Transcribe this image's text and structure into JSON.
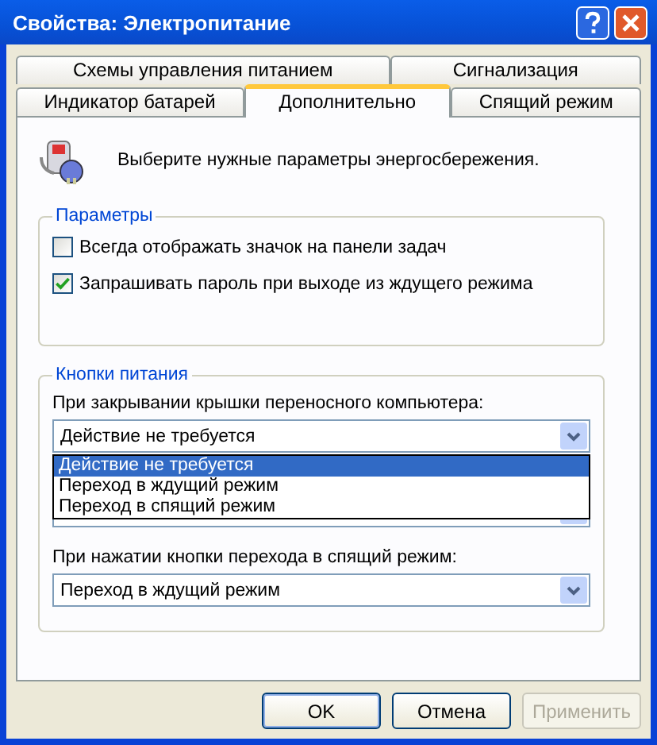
{
  "window": {
    "title": "Свойства: Электропитание"
  },
  "tab_rows": [
    {
      "tabs": [
        {
          "label": "Схемы управления питанием",
          "selected": false
        },
        {
          "label": "Сигнализация",
          "selected": false
        }
      ]
    },
    {
      "tabs": [
        {
          "label": "Индикатор батарей",
          "selected": false
        },
        {
          "label": "Дополнительно",
          "selected": true
        },
        {
          "label": "Спящий режим",
          "selected": false
        }
      ]
    }
  ],
  "intro": "Выберите нужные параметры энергосбережения.",
  "settings": {
    "title": "Параметры",
    "checkboxes": [
      {
        "label": "Всегда отображать значок на панели задач",
        "checked": false
      },
      {
        "label": "Запрашивать пароль при выходе из ждущего режима",
        "checked": true
      }
    ]
  },
  "power_buttons": {
    "title": "Кнопки питания",
    "lid": {
      "label": "При закрывании крышки переносного компьютера:",
      "value": "Действие не требуется",
      "expanded": true,
      "options": [
        {
          "label": "Действие не требуется",
          "selected": true
        },
        {
          "label": "Переход в ждущий режим",
          "selected": false
        },
        {
          "label": "Переход в спящий режим",
          "selected": false
        }
      ]
    },
    "sleep": {
      "label": "При нажатии кнопки перехода в спящий режим:",
      "value": "Переход в ждущий режим"
    }
  },
  "buttons": [
    {
      "label": "OK",
      "disabled": false,
      "default": true
    },
    {
      "label": "Отмена",
      "disabled": false,
      "default": false
    },
    {
      "label": "Применить",
      "disabled": true,
      "default": false
    }
  ]
}
